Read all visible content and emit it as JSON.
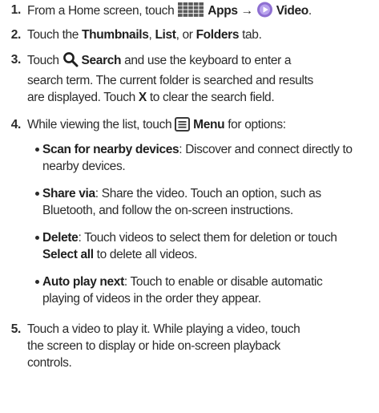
{
  "steps": [
    {
      "num": "1.",
      "a": "From a Home screen, touch ",
      "apps": "Apps",
      "arrow": "→",
      "video": "Video",
      "end": "."
    },
    {
      "num": "2.",
      "a": "Touch the ",
      "thumbnails": "Thumbnails",
      "b": ", ",
      "list": "List",
      "c": ", or ",
      "folders": "Folders",
      "d": " tab."
    },
    {
      "num": "3.",
      "a": "Touch ",
      "search": "Search",
      "b": " and use the keyboard to enter a",
      "line2": "search term. The current folder is searched and results",
      "line3a": "are displayed. Touch ",
      "x": "X",
      "line3b": " to clear the search field."
    },
    {
      "num": "4.",
      "a": "While viewing the list, touch ",
      "menu": "Menu",
      "b": " for options:"
    },
    {
      "num": "5.",
      "line1": "Touch a video to play it. While playing a video, touch",
      "line2": "the screen to display or hide on-screen playback",
      "line3": "controls."
    }
  ],
  "options": [
    {
      "term": "Scan for nearby devices",
      "line1": ": Discover and connect directly to",
      "line2": "nearby devices."
    },
    {
      "term": "Share via",
      "line1": ": Share the video. Touch an option, such as",
      "line2": "Bluetooth, and follow the on-screen instructions."
    },
    {
      "term": "Delete",
      "line1": ": Touch videos to select them for deletion or touch",
      "line2_term": "Select all",
      "line2": " to delete all videos."
    },
    {
      "term": "Auto play next",
      "line1": ": Touch to enable or disable automatic",
      "line2": "playing of videos in the order they appear."
    }
  ],
  "icons": {
    "apps": "apps-grid-icon",
    "video": "video-app-icon",
    "search": "magnifier-icon",
    "menu": "menu-icon"
  },
  "colors": {
    "text": "#2b2b2b",
    "video_icon": "#8e6fd1"
  }
}
